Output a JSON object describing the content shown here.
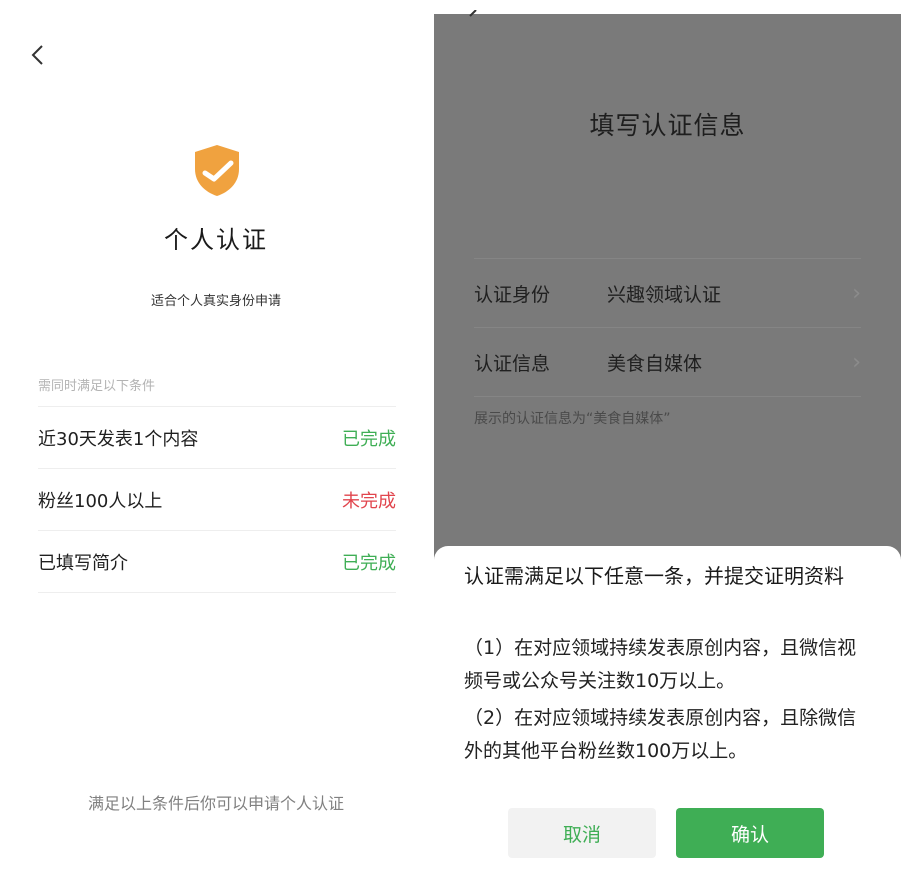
{
  "left": {
    "title": "个人认证",
    "subtitle": "适合个人真实身份申请",
    "conditions_heading": "需同时满足以下条件",
    "conditions": [
      {
        "label": "近30天发表1个内容",
        "status": "已完成",
        "done": true
      },
      {
        "label": "粉丝100人以上",
        "status": "未完成",
        "done": false
      },
      {
        "label": "已填写简介",
        "status": "已完成",
        "done": true
      }
    ],
    "footer": "满足以上条件后你可以申请个人认证"
  },
  "right": {
    "title": "填写认证信息",
    "rows": [
      {
        "key": "认证身份",
        "value": "兴趣领域认证"
      },
      {
        "key": "认证信息",
        "value": "美食自媒体"
      }
    ],
    "hint": "展示的认证信息为“美食自媒体”",
    "sheet": {
      "heading": "认证需满足以下任意一条，并提交证明资料",
      "item1": "（1）在对应领域持续发表原创内容，且微信视频号或公众号关注数10万以上。",
      "item2": "（2）在对应领域持续发表原创内容，且除微信外的其他平台粉丝数100万以上。",
      "cancel_label": "取消",
      "confirm_label": "确认"
    }
  },
  "colors": {
    "accent_green": "#3fae55",
    "warning_red": "#e1454d",
    "shield_orange": "#f0a23f"
  }
}
